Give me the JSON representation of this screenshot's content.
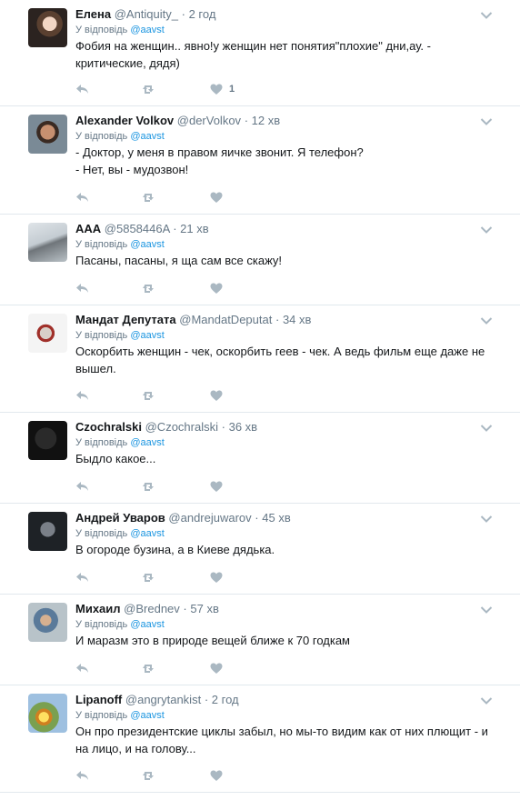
{
  "colors": {
    "accent": "#1b95e0",
    "muted": "#657786",
    "icon": "#aab8c2",
    "divider": "#e1e8ed"
  },
  "icons": {
    "reply": "reply-icon",
    "retweet": "retweet-icon",
    "like": "heart-icon",
    "menu": "chevron-down-icon"
  },
  "tweets": [
    {
      "name": "Елена",
      "handle": "@Antiquity_",
      "sep": "·",
      "time": "2 год",
      "reply_prefix": "У відповідь",
      "reply_to": "@aavst",
      "text": "Фобия на женщин.. явно!у женщин нет понятия\"плохие\" дни,ау. - критические, дядя)",
      "likes": "1"
    },
    {
      "name": "Alexander Volkov",
      "handle": "@derVolkov",
      "sep": "·",
      "time": "12 хв",
      "reply_prefix": "У відповідь",
      "reply_to": "@aavst",
      "text": "- Доктор, у меня в правом яичке звонит. Я телефон?\n- Нет, вы - мудозвон!",
      "likes": ""
    },
    {
      "name": "AAA",
      "handle": "@5858446A",
      "sep": "·",
      "time": "21 хв",
      "reply_prefix": "У відповідь",
      "reply_to": "@aavst",
      "text": "Пасаны, пасаны, я ща сам все скажу!",
      "likes": ""
    },
    {
      "name": "Мандат Депутата",
      "handle": "@MandatDeputat",
      "sep": "·",
      "time": "34 хв",
      "reply_prefix": "У відповідь",
      "reply_to": "@aavst",
      "text": "Оскорбить женщин - чек, оскорбить геев - чек. А ведь фильм еще даже не вышел.",
      "likes": ""
    },
    {
      "name": "Czochralski",
      "handle": "@Czochralski",
      "sep": "·",
      "time": "36 хв",
      "reply_prefix": "У відповідь",
      "reply_to": "@aavst",
      "text": "Быдло какое...",
      "likes": ""
    },
    {
      "name": "Андрей Уваров",
      "handle": "@andrejuwarov",
      "sep": "·",
      "time": "45 хв",
      "reply_prefix": "У відповідь",
      "reply_to": "@aavst",
      "text": "В огороде бузина, а в Киеве дядька.",
      "likes": ""
    },
    {
      "name": "Михаил",
      "handle": "@Brednev",
      "sep": "·",
      "time": "57 хв",
      "reply_prefix": "У відповідь",
      "reply_to": "@aavst",
      "text": "И маразм это в природе вещей ближе к 70 годкам",
      "likes": ""
    },
    {
      "name": "Lipanoff",
      "handle": "@angrytankist",
      "sep": "·",
      "time": "2 год",
      "reply_prefix": "У відповідь",
      "reply_to": "@aavst",
      "text": "Он про президентские циклы забыл, но мы-то видим как от них плющит - и на лицо, и на голову...",
      "likes": ""
    }
  ]
}
